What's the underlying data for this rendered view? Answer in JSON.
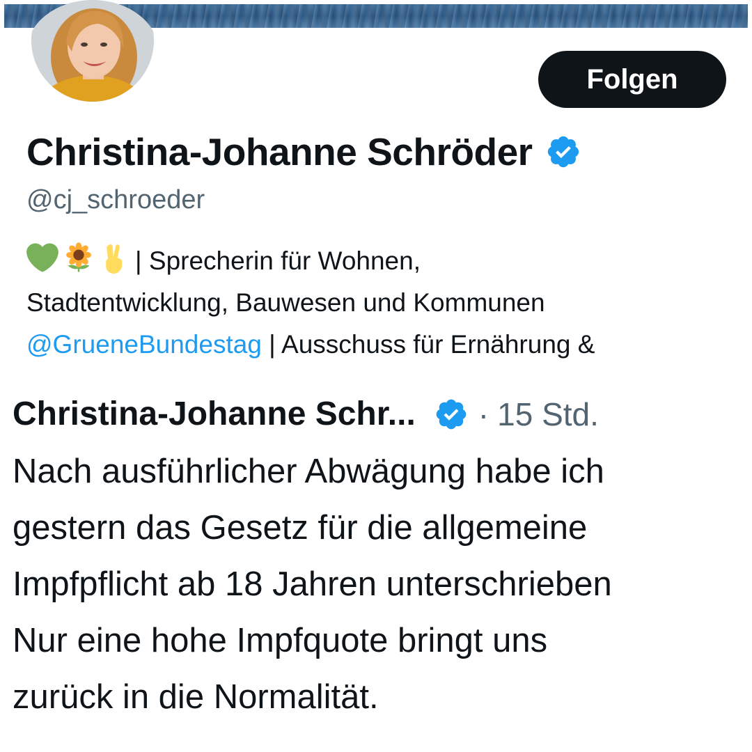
{
  "profile": {
    "follow_label": "Folgen",
    "display_name": "Christina-Johanne Schröder",
    "handle": "@cj_schroeder",
    "verified": true,
    "bio": {
      "emojis": [
        "green-heart",
        "sunflower",
        "victory-hand"
      ],
      "line1_text": "| Sprecherin für Wohnen,",
      "line2_text": "Stadtentwicklung, Bauwesen und Kommunen",
      "line3_mention": "@GrueneBundestag",
      "line3_text": " | Ausschuss für Ernährung &"
    }
  },
  "tweet": {
    "author": "Christina-Johanne Schr...",
    "verified": true,
    "separator": "·",
    "time": "15 Std.",
    "lines": [
      "Nach ausführlicher Abwägung habe ich",
      "gestern das Gesetz für die allgemeine",
      "Impfpflicht ab 18 Jahren unterschrieben",
      "Nur eine hohe Impfquote bringt uns",
      "zurück in die Normalität."
    ]
  },
  "colors": {
    "accent_blue": "#1d9bf0",
    "text_primary": "#0f1419",
    "text_secondary": "#536471",
    "button_bg": "#0f1419"
  },
  "icons": {
    "verified": "verified-badge-icon",
    "bio_emojis": [
      "green-heart-icon",
      "sunflower-icon",
      "victory-hand-icon"
    ]
  }
}
